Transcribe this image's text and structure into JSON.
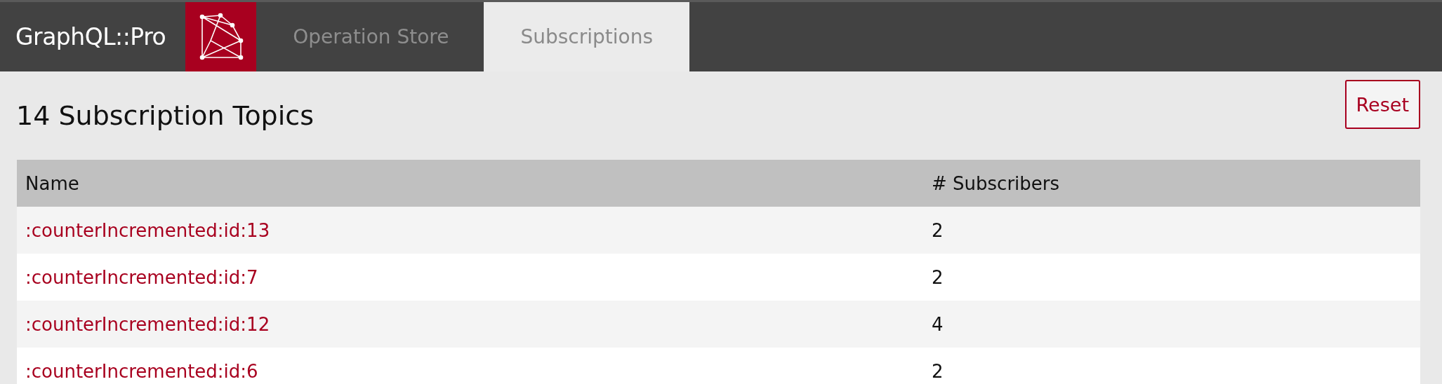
{
  "navbar": {
    "brand": "GraphQL::Pro",
    "tabs": [
      {
        "label": "Operation Store",
        "selected": false
      },
      {
        "label": "Subscriptions",
        "selected": true
      }
    ]
  },
  "page": {
    "title": "14 Subscription Topics",
    "reset_button": "Reset"
  },
  "table": {
    "columns": [
      "Name",
      "# Subscribers"
    ],
    "rows": [
      {
        "name": ":counterIncremented:id:13",
        "subscribers": "2"
      },
      {
        "name": ":counterIncremented:id:7",
        "subscribers": "2"
      },
      {
        "name": ":counterIncremented:id:12",
        "subscribers": "4"
      },
      {
        "name": ":counterIncremented:id:6",
        "subscribers": "2"
      }
    ]
  }
}
